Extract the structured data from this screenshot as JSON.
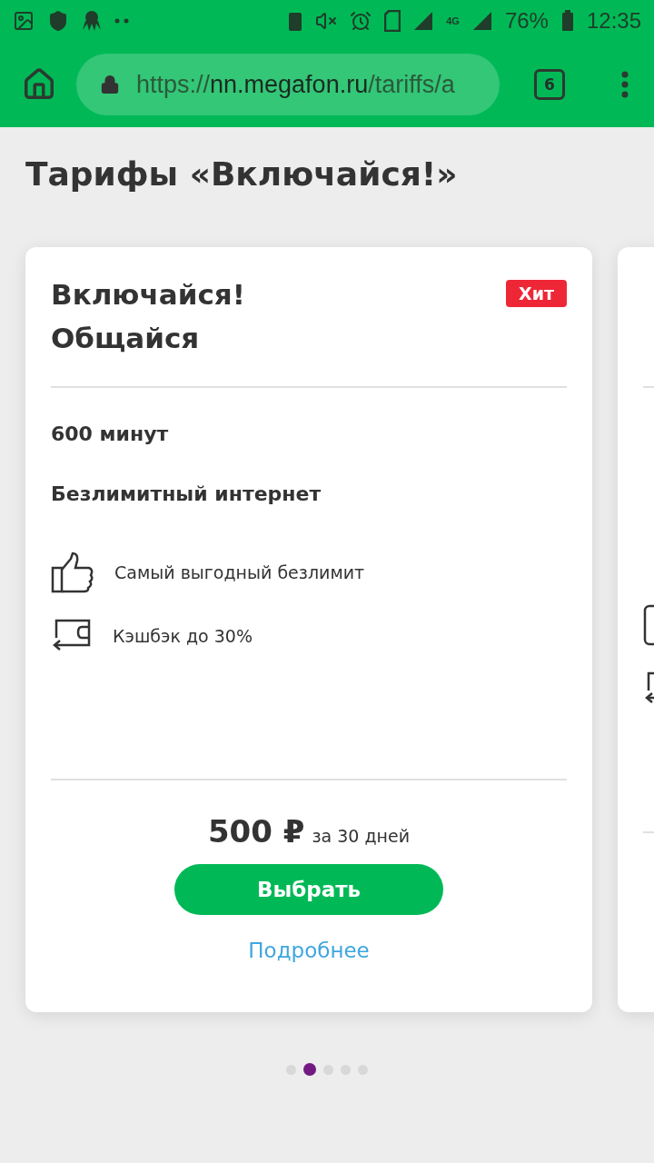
{
  "status_bar": {
    "network": "4G",
    "battery": "76%",
    "time": "12:35"
  },
  "browser": {
    "url_scheme": "https://",
    "url_host": "nn.megafon.ru",
    "url_path": "/tariffs/a",
    "tab_count": "6"
  },
  "page": {
    "title": "Тарифы «Включайся!»"
  },
  "tariffs": [
    {
      "title_lines": [
        "Включайся!",
        "Общайся"
      ],
      "badge": "Хит",
      "features": [
        "600 минут",
        "Безлимитный интернет"
      ],
      "perks": [
        {
          "kind": "thumbs-up",
          "text": "Самый выгодный безлимит"
        },
        {
          "kind": "cashback",
          "text": "Кэшбэк до 30%"
        }
      ],
      "price": "500 ₽",
      "period": "за 30 дней",
      "button": "Выбрать",
      "link": "Подробнее"
    },
    {
      "perks": [
        {
          "kind": "device"
        },
        {
          "kind": "cashback"
        }
      ]
    }
  ],
  "pager": [
    {
      "selected": false
    },
    {
      "selected": true
    },
    {
      "selected": false
    },
    {
      "selected": false
    },
    {
      "selected": false
    }
  ]
}
